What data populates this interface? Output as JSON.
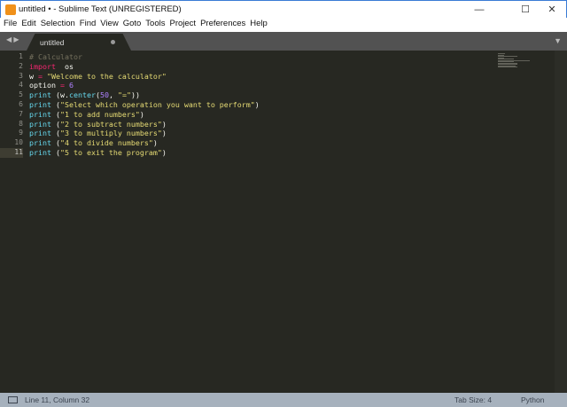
{
  "window": {
    "title": "untitled • - Sublime Text (UNREGISTERED)",
    "minimize": "—",
    "maximize": "☐",
    "close": "✕",
    "logo": "S"
  },
  "menu": [
    "File",
    "Edit",
    "Selection",
    "Find",
    "View",
    "Goto",
    "Tools",
    "Project",
    "Preferences",
    "Help"
  ],
  "tabs": [
    {
      "label": "untitled",
      "dirty": true
    }
  ],
  "nav": {
    "arrows": "◀ ▶",
    "tab_menu": "▼"
  },
  "editor": {
    "line_numbers": [
      "1",
      "2",
      "3",
      "4",
      "5",
      "6",
      "7",
      "8",
      "9",
      "10",
      "11"
    ],
    "lines": [
      [
        [
          "c",
          "# Calculator"
        ]
      ],
      [
        [
          "k",
          "import"
        ],
        [
          "",
          "  os"
        ]
      ],
      [
        [
          "",
          "w "
        ],
        [
          "k",
          "="
        ],
        [
          "s",
          " \"Welcome to the calculator\""
        ]
      ],
      [
        [
          "",
          "option "
        ],
        [
          "k",
          "="
        ],
        [
          "n",
          " 6"
        ]
      ],
      [
        [
          "f",
          "print"
        ],
        [
          "",
          " (w."
        ],
        [
          "f",
          "center"
        ],
        [
          "",
          "("
        ],
        [
          "n",
          "50"
        ],
        [
          "",
          ", "
        ],
        [
          "s",
          "\"=\""
        ],
        [
          "",
          "))"
        ]
      ],
      [
        [
          "f",
          "print"
        ],
        [
          "",
          " ("
        ],
        [
          "s",
          "\"Select which operation you want to perform\""
        ],
        [
          "",
          ")"
        ]
      ],
      [
        [
          "f",
          "print"
        ],
        [
          "",
          " ("
        ],
        [
          "s",
          "\"1 to add numbers\""
        ],
        [
          "",
          ")"
        ]
      ],
      [
        [
          "f",
          "print"
        ],
        [
          "",
          " ("
        ],
        [
          "s",
          "\"2 to subtract numbers\""
        ],
        [
          "",
          ")"
        ]
      ],
      [
        [
          "f",
          "print"
        ],
        [
          "",
          " ("
        ],
        [
          "s",
          "\"3 to multiply numbers\""
        ],
        [
          "",
          ")"
        ]
      ],
      [
        [
          "f",
          "print"
        ],
        [
          "",
          " ("
        ],
        [
          "s",
          "\"4 to divide numbers\""
        ],
        [
          "",
          ")"
        ]
      ],
      [
        [
          "f",
          "print"
        ],
        [
          "",
          " ("
        ],
        [
          "s",
          "\"5 to exit the program\""
        ],
        [
          "",
          ")"
        ]
      ]
    ],
    "current_line": 11
  },
  "status": {
    "position": "Line 11, Column 32",
    "tab_size": "Tab Size: 4",
    "syntax": "Python"
  }
}
